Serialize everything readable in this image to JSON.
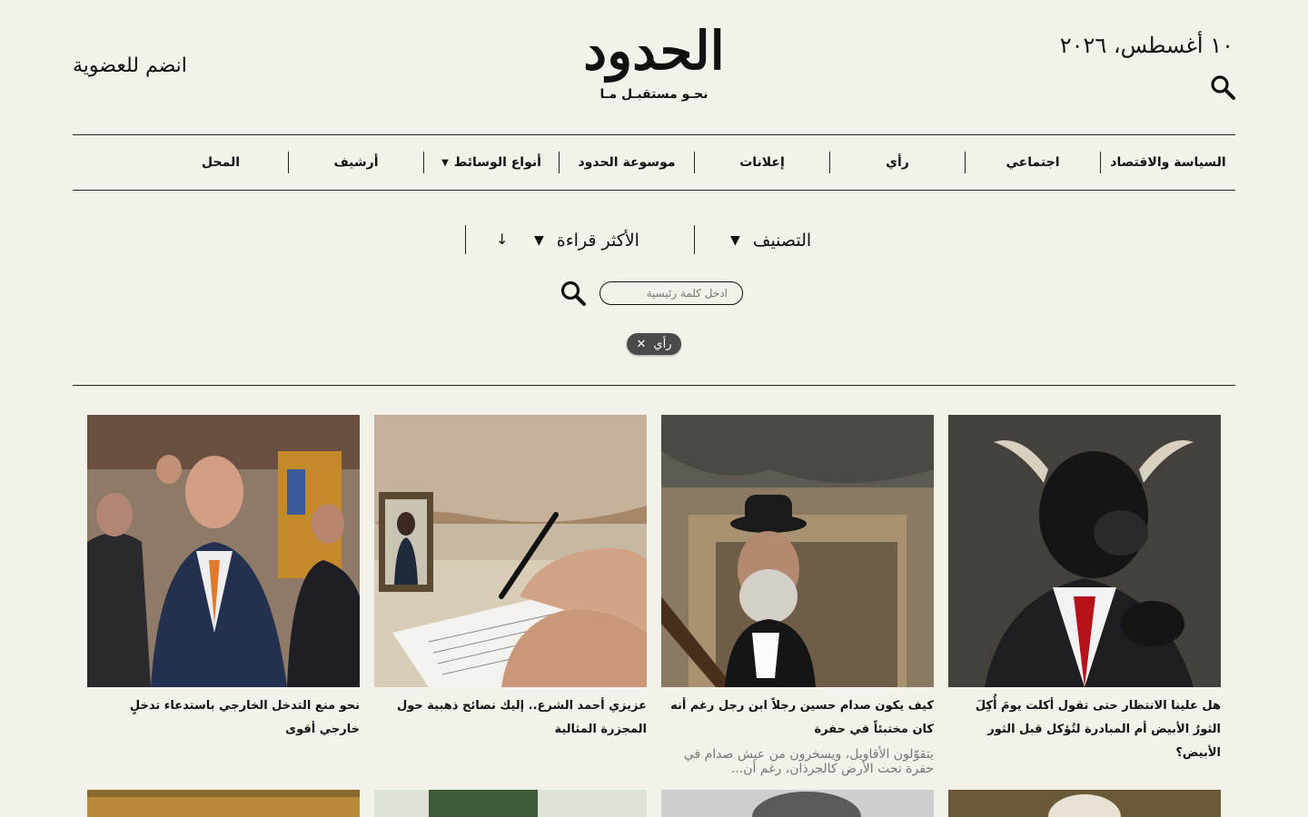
{
  "header": {
    "date": "١٠ أغسطس، ٢٠٢٦",
    "join_label": "انضم للعضوية",
    "logo_text": "الحدود",
    "logo_tagline": "نحـو مستقبـل مـا"
  },
  "nav": {
    "items": [
      {
        "label": "السياسة والاقتصاد"
      },
      {
        "label": "اجتماعي"
      },
      {
        "label": "رأي"
      },
      {
        "label": "إعلانات"
      },
      {
        "label": "موسوعة الحدود"
      },
      {
        "label": "أنواع الوسائط"
      },
      {
        "label": "أرشيف"
      },
      {
        "label": "المحل"
      }
    ]
  },
  "filters": {
    "category_label": "التصنيف",
    "sort_label": "الأكثر قراءة",
    "keyword_placeholder": "ادخل كلمة رئيسية",
    "active_chip": "رأي"
  },
  "articles": [
    {
      "title": "هل علينا الانتظار حتى تقول أكلت يومَ أُكِلَ الثورُ الأبيض أم المبادرة لتُؤكل قبل الثور الأبيض؟",
      "excerpt": ""
    },
    {
      "title": "كيف يكون صدام حسين رجلاً ابن رجل رغم أنه كان مختبئاً في حفرة",
      "excerpt": "يتقوّلون الأقاويل، ويسخرون من عيش صدام في حفرة تحت الأرض كالجرذان، رغم أن..."
    },
    {
      "title": "عزيزي أحمد الشرع.. إليك نصائح ذهبية حول المجزرة المثالية",
      "excerpt": ""
    },
    {
      "title": "نحو منع التدخل الخارجي باستدعاء تدخلٍ خارجي أقوى",
      "excerpt": ""
    }
  ],
  "colors": {
    "background": "#f2f1ea",
    "text": "#111111",
    "chip_bg": "#4a4a4a",
    "muted": "#777777"
  }
}
